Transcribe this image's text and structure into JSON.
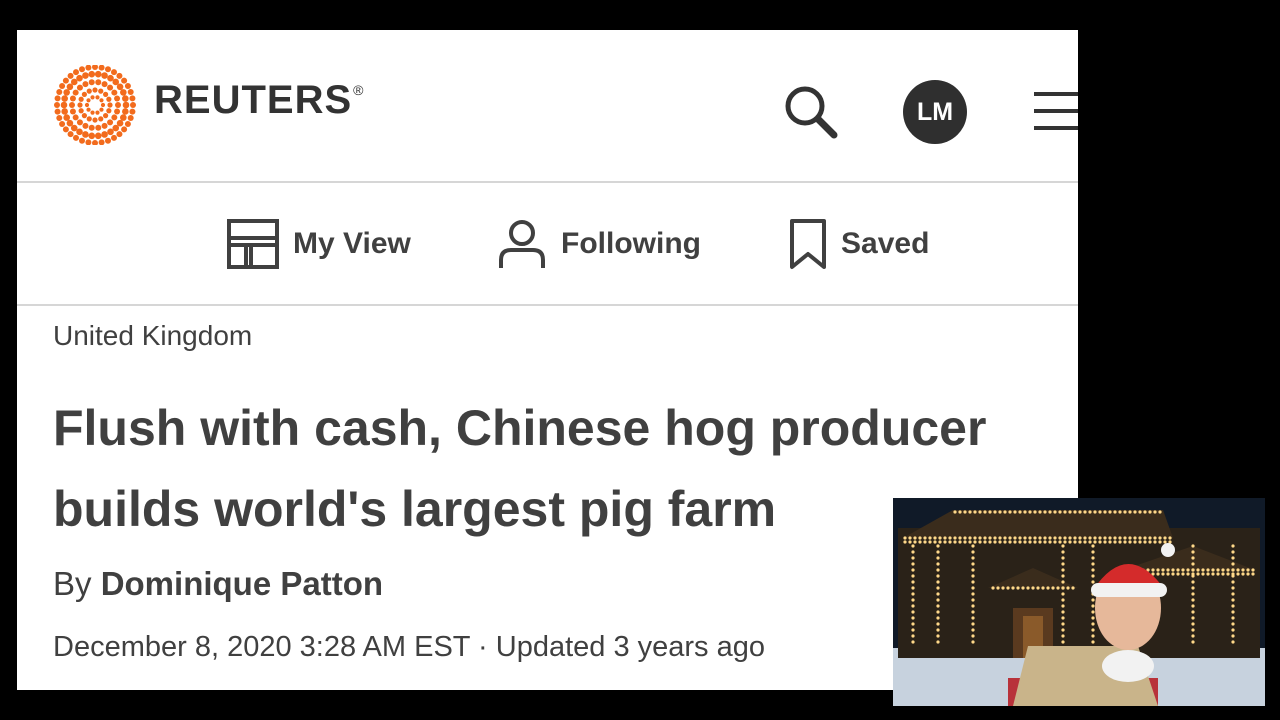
{
  "header": {
    "brand_name": "REUTERS",
    "registered_mark": "®",
    "avatar_initials": "LM"
  },
  "subnav": {
    "items": [
      {
        "label": "My View",
        "icon": "layout-icon"
      },
      {
        "label": "Following",
        "icon": "person-icon"
      },
      {
        "label": "Saved",
        "icon": "bookmark-icon"
      }
    ]
  },
  "article": {
    "section": "United Kingdom",
    "headline": "Flush with cash, Chinese hog producer builds world's largest pig farm",
    "byline_prefix": "By",
    "author": "Dominique Patton",
    "dateline": "December 8, 2020 3:28 AM EST · Updated 3 years ago"
  },
  "colors": {
    "brand_orange": "#f26b1d",
    "text": "#404040",
    "avatar_bg": "#2f2f2f",
    "frame_bg": "#000000"
  }
}
